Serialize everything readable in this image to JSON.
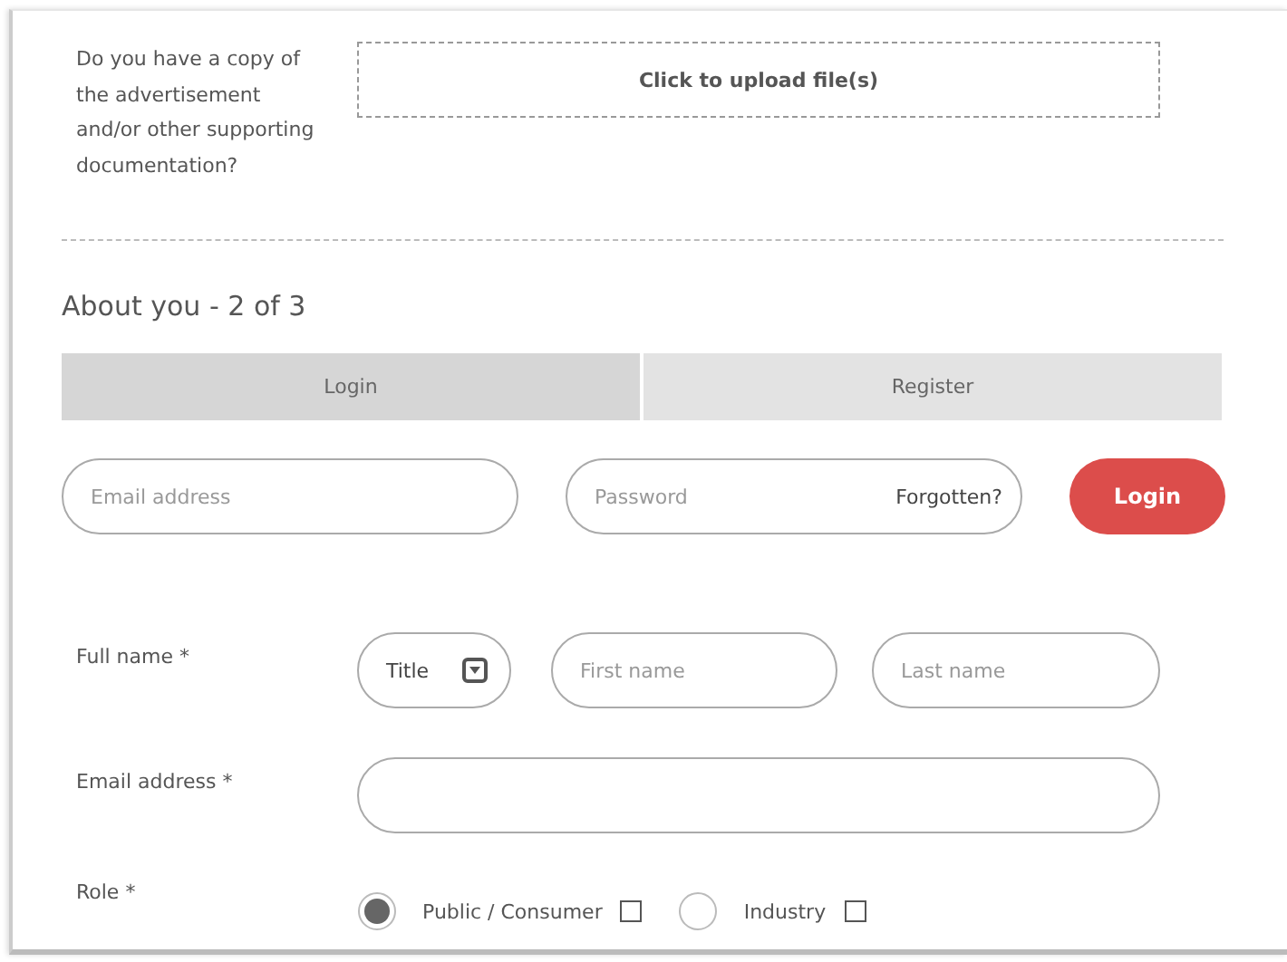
{
  "upload": {
    "question": "Do you have a copy of the advertisement and/or other supporting documentation?",
    "button": "Click to upload file(s)"
  },
  "section": {
    "heading": "About you - 2 of 3"
  },
  "tabs": [
    {
      "label": "Login",
      "selected": true
    },
    {
      "label": "Register",
      "selected": false
    }
  ],
  "login": {
    "email_placeholder": "Email address",
    "password_placeholder": "Password",
    "forgotten": "Forgotten?",
    "button": "Login"
  },
  "full_name": {
    "label": "Full name *",
    "title": "Title",
    "first_placeholder": "First name",
    "last_placeholder": "Last name"
  },
  "email": {
    "label": "Email address *"
  },
  "role": {
    "label": "Role *",
    "options": [
      {
        "label": "Public / Consumer",
        "selected": true,
        "checked": false
      },
      {
        "label": "Industry",
        "selected": false,
        "checked": false
      }
    ]
  }
}
